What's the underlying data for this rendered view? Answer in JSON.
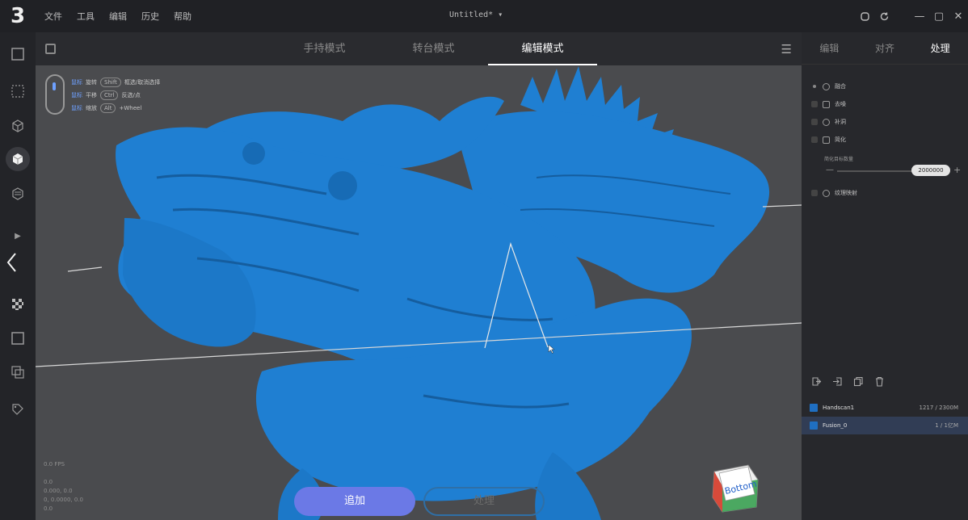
{
  "app": {
    "logo": "3",
    "menu": [
      "文件",
      "工具",
      "编辑",
      "历史",
      "帮助"
    ],
    "doc_title": "Untitled*",
    "doc_title_caret": "▾"
  },
  "window_controls": {
    "cloud_icon": "cloud-icon",
    "refresh_icon": "refresh-icon",
    "minimize": "—",
    "maximize": "▢",
    "close": "✕"
  },
  "left_toolbar": {
    "tools": [
      "frame-icon",
      "point-cloud-icon",
      "box-outline-icon",
      "cube-solid-icon",
      "layers-icon",
      "play-icon",
      "back-chevron-icon",
      "checker-icon",
      "square-icon",
      "copy-icon",
      "paint-icon"
    ]
  },
  "viewport": {
    "mode_tabs": [
      "手持模式",
      "转台模式",
      "编辑模式"
    ],
    "active_mode": "编辑模式",
    "hints": {
      "rows": [
        {
          "key": "鼠标",
          "action": "旋转",
          "pill": "Shift",
          "note": "框选/取消选择"
        },
        {
          "key": "鼠标",
          "action": "平移",
          "pill": "Ctrl",
          "note": "反选/点"
        },
        {
          "key": "鼠标",
          "action": "缩放",
          "pill": "Alt",
          "note": "+Wheel"
        }
      ]
    },
    "coords": [
      "0.0 FPS",
      "",
      "0.0",
      "0.000, 0.0",
      "0, 0.0000, 0.0",
      "0.0"
    ],
    "view_cube_label": "Bottom",
    "add_button": "追加",
    "process_button": "处理"
  },
  "right_panel": {
    "tabs": [
      "编辑",
      "对齐",
      "处理"
    ],
    "active_tab": "处理",
    "process_items": [
      {
        "label": "融合",
        "checked": true
      },
      {
        "label": "去噪",
        "checked": false
      },
      {
        "label": "补洞",
        "checked": false
      },
      {
        "label": "简化",
        "checked": false
      }
    ],
    "simplify_label": "简化目标数量",
    "simplify_value": "2000000",
    "texture_item": "纹理映射",
    "layers": [
      {
        "name": "Handscan1",
        "count": "1217 / 2300M",
        "selected": false
      },
      {
        "name": "Fusion_0",
        "count": "1 / 1亿M",
        "selected": true
      }
    ]
  },
  "colors": {
    "model_blue": "#1f7fd2",
    "accent_purple": "#6b79e6",
    "viewport_bg": "#4a4b4e"
  }
}
